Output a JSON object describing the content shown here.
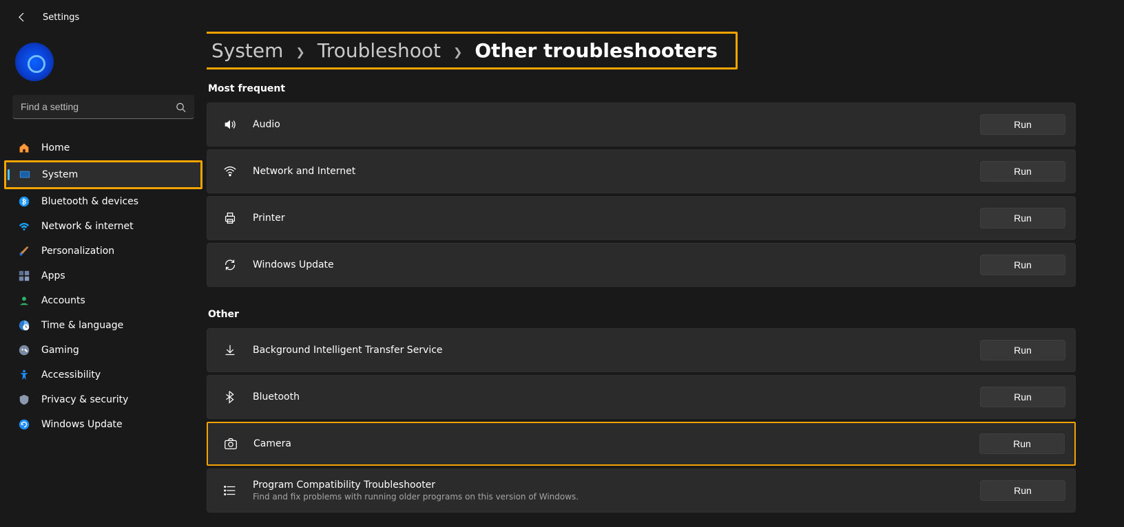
{
  "app": {
    "title": "Settings"
  },
  "search": {
    "placeholder": "Find a setting"
  },
  "sidebar": {
    "items": [
      {
        "label": "Home"
      },
      {
        "label": "System"
      },
      {
        "label": "Bluetooth & devices"
      },
      {
        "label": "Network & internet"
      },
      {
        "label": "Personalization"
      },
      {
        "label": "Apps"
      },
      {
        "label": "Accounts"
      },
      {
        "label": "Time & language"
      },
      {
        "label": "Gaming"
      },
      {
        "label": "Accessibility"
      },
      {
        "label": "Privacy & security"
      },
      {
        "label": "Windows Update"
      }
    ]
  },
  "breadcrumb": {
    "level1": "System",
    "level2": "Troubleshoot",
    "level3": "Other troubleshooters"
  },
  "sections": {
    "most_frequent": {
      "label": "Most frequent",
      "items": [
        {
          "title": "Audio",
          "button": "Run"
        },
        {
          "title": "Network and Internet",
          "button": "Run"
        },
        {
          "title": "Printer",
          "button": "Run"
        },
        {
          "title": "Windows Update",
          "button": "Run"
        }
      ]
    },
    "other": {
      "label": "Other",
      "items": [
        {
          "title": "Background Intelligent Transfer Service",
          "button": "Run"
        },
        {
          "title": "Bluetooth",
          "button": "Run"
        },
        {
          "title": "Camera",
          "button": "Run"
        },
        {
          "title": "Program Compatibility Troubleshooter",
          "sub": "Find and fix problems with running older programs on this version of Windows.",
          "button": "Run"
        }
      ]
    }
  }
}
